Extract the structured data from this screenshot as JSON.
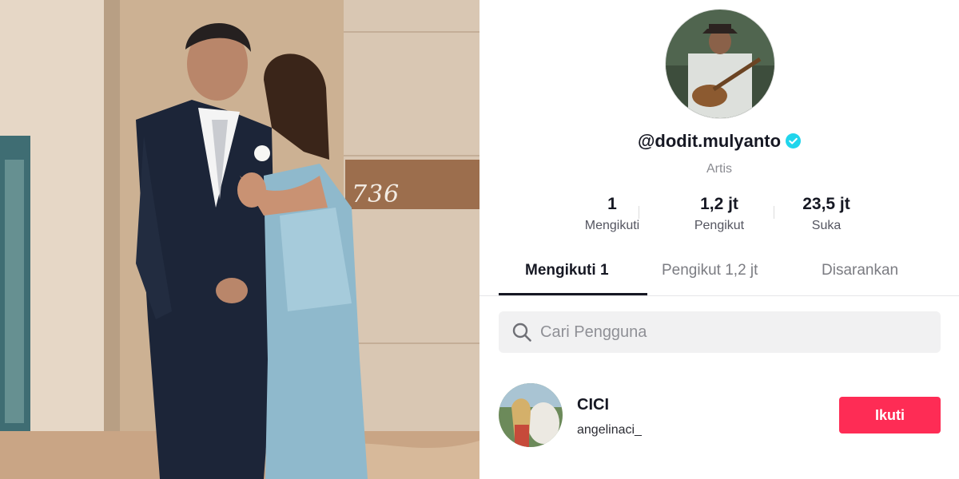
{
  "photo": {
    "room_number": "736"
  },
  "profile": {
    "username": "@dodit.mulyanto",
    "role": "Artis",
    "verified": true,
    "stats": [
      {
        "value": "1",
        "label": "Mengikuti"
      },
      {
        "value": "1,2 jt",
        "label": "Pengikut"
      },
      {
        "value": "23,5 jt",
        "label": "Suka"
      }
    ]
  },
  "tabs": [
    {
      "label": "Mengikuti 1",
      "active": true
    },
    {
      "label": "Pengikut 1,2 jt",
      "active": false
    },
    {
      "label": "Disarankan",
      "active": false
    }
  ],
  "search": {
    "placeholder": "Cari Pengguna",
    "value": ""
  },
  "following": [
    {
      "name": "CICI",
      "handle": "angelinaci_",
      "button_label": "Ikuti"
    }
  ],
  "colors": {
    "accent_pink": "#fe2c55",
    "verified_blue": "#20d5ec",
    "text_primary": "#161823",
    "text_secondary": "#8a8b91"
  },
  "icons": {
    "verified": "verified-badge-icon",
    "search": "search-icon"
  }
}
